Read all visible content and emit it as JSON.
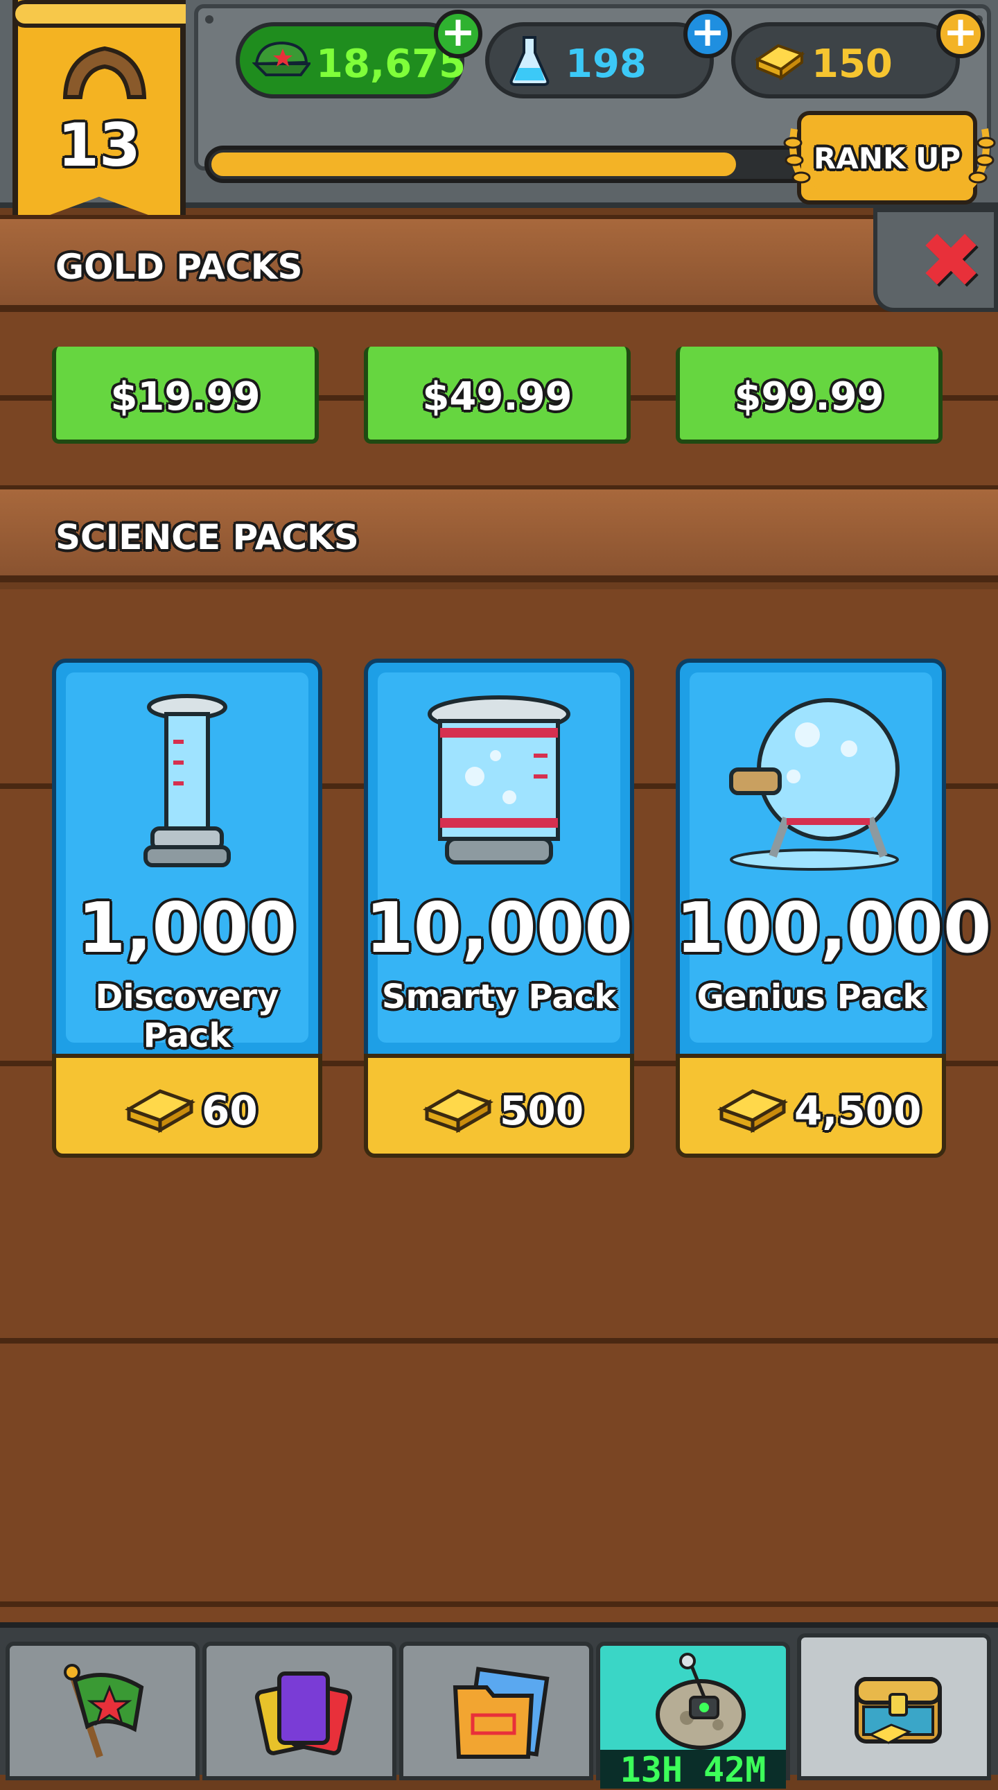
{
  "header": {
    "rank_level": "13",
    "cash": "18,675",
    "science": "198",
    "gold": "150",
    "rank_up_label": "RANK UP",
    "xp_progress": 0.86
  },
  "gold_packs": {
    "title": "GOLD PACKS",
    "prices": [
      "$19.99",
      "$49.99",
      "$99.99"
    ]
  },
  "science_packs": {
    "title": "SCIENCE PACKS",
    "packs": [
      {
        "amount": "1,000",
        "name": "Discovery Pack",
        "price": "60"
      },
      {
        "amount": "10,000",
        "name": "Smarty Pack",
        "price": "500"
      },
      {
        "amount": "100,000",
        "name": "Genius Pack",
        "price": "4,500"
      }
    ]
  },
  "bottom_nav": {
    "timer": "13H 42M"
  },
  "colors": {
    "wood": "#7a4523",
    "gold_accent": "#f3b326",
    "green_button": "#66d640",
    "science_blue": "#36b4f5",
    "close_red": "#e8303a"
  }
}
